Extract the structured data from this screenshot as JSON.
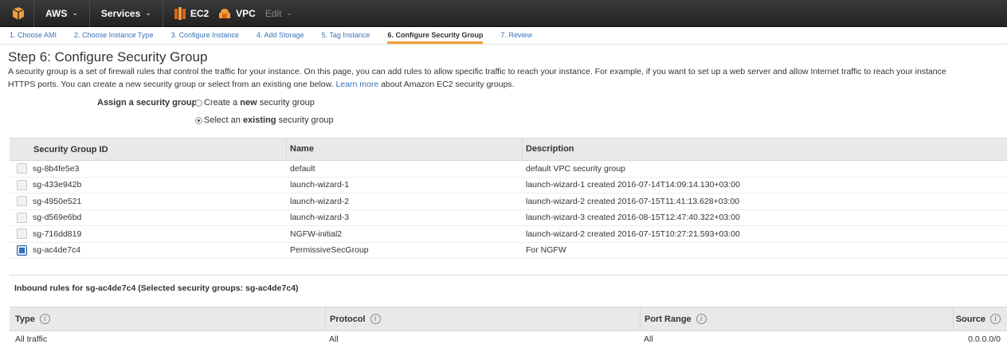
{
  "topbar": {
    "aws": "AWS",
    "services": "Services",
    "ec2": "EC2",
    "vpc": "VPC",
    "edit": "Edit"
  },
  "tabs": [
    "1. Choose AMI",
    "2. Choose Instance Type",
    "3. Configure Instance",
    "4. Add Storage",
    "5. Tag Instance",
    "6. Configure Security Group",
    "7. Review"
  ],
  "page": {
    "title": "Step 6: Configure Security Group",
    "desc_line1": "A security group is a set of firewall rules that control the traffic for your instance. On this page, you can add rules to allow specific traffic to reach your instance. For example, if you want to set up a web server and allow Internet traffic to reach your instance",
    "desc_line2_a": "HTTPS ports. You can create a new security group or select from an existing one below.",
    "learn_more": "Learn more",
    "desc_line2_b": "about Amazon EC2 security groups."
  },
  "assign": {
    "label": "Assign a security group:",
    "option_new_pre": "Create a ",
    "option_new_bold": "new",
    "option_new_post": " security group",
    "option_existing_pre": "Select an ",
    "option_existing_bold": "existing",
    "option_existing_post": " security group",
    "selected": "existing"
  },
  "sg_table": {
    "headers": [
      "Security Group ID",
      "Name",
      "Description"
    ],
    "rows": [
      {
        "id": "sg-8b4fe5e3",
        "name": "default",
        "desc": "default VPC security group",
        "checked": false
      },
      {
        "id": "sg-433e942b",
        "name": "launch-wizard-1",
        "desc": "launch-wizard-1 created 2016-07-14T14:09:14.130+03:00",
        "checked": false
      },
      {
        "id": "sg-4950e521",
        "name": "launch-wizard-2",
        "desc": "launch-wizard-2 created 2016-07-15T11:41:13.628+03:00",
        "checked": false
      },
      {
        "id": "sg-d569e6bd",
        "name": "launch-wizard-3",
        "desc": "launch-wizard-3 created 2016-08-15T12:47:40.322+03:00",
        "checked": false
      },
      {
        "id": "sg-716dd819",
        "name": "NGFW-initial2",
        "desc": "launch-wizard-2 created 2016-07-15T10:27:21.593+03:00",
        "checked": false
      },
      {
        "id": "sg-ac4de7c4",
        "name": "PermissiveSecGroup",
        "desc": "For NGFW",
        "checked": true
      }
    ]
  },
  "inbound": {
    "title": "Inbound rules for sg-ac4de7c4 (Selected security groups: sg-ac4de7c4)",
    "headers": [
      "Type",
      "Protocol",
      "Port Range",
      "Source"
    ],
    "rows": [
      {
        "type": "All traffic",
        "protocol": "All",
        "port": "All",
        "source": "0.0.0.0/0"
      }
    ]
  },
  "colors": {
    "accent": "#f29d38",
    "link": "#3a72b5",
    "nav_bg": "#222222"
  }
}
